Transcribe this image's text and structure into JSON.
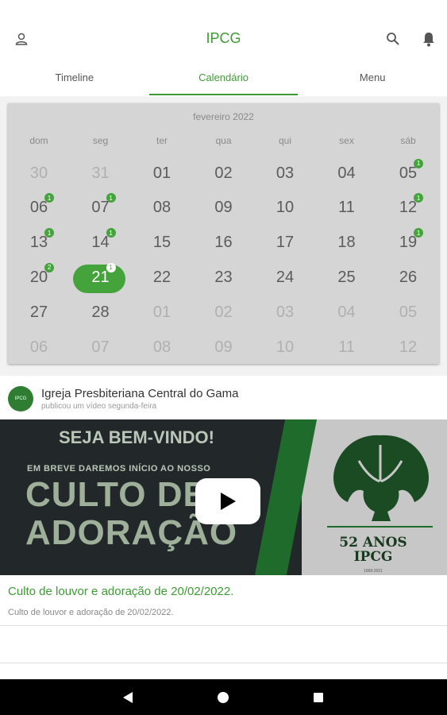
{
  "appbar": {
    "title": "IPCG",
    "profile_icon": "person-icon",
    "search_icon": "search-icon",
    "bell_icon": "bell-icon"
  },
  "tabs": [
    {
      "label": "Timeline",
      "active": false
    },
    {
      "label": "Calendário",
      "active": true
    },
    {
      "label": "Menu",
      "active": false
    }
  ],
  "calendar": {
    "month": "fevereiro 2022",
    "weekdays": [
      "dom",
      "seg",
      "ter",
      "qua",
      "qui",
      "sex",
      "sáb"
    ],
    "accent": "#45a33c",
    "weeks": [
      [
        {
          "d": "30",
          "other": true
        },
        {
          "d": "31",
          "other": true
        },
        {
          "d": "01"
        },
        {
          "d": "02"
        },
        {
          "d": "03"
        },
        {
          "d": "04"
        },
        {
          "d": "05",
          "badge": "1"
        }
      ],
      [
        {
          "d": "06",
          "badge": "1"
        },
        {
          "d": "07",
          "badge": "1"
        },
        {
          "d": "08"
        },
        {
          "d": "09"
        },
        {
          "d": "10"
        },
        {
          "d": "11"
        },
        {
          "d": "12",
          "badge": "1"
        }
      ],
      [
        {
          "d": "13",
          "badge": "1"
        },
        {
          "d": "14",
          "badge": "1"
        },
        {
          "d": "15"
        },
        {
          "d": "16"
        },
        {
          "d": "17"
        },
        {
          "d": "18"
        },
        {
          "d": "19",
          "badge": "1"
        }
      ],
      [
        {
          "d": "20",
          "badge": "2"
        },
        {
          "d": "21",
          "badge": "1",
          "selected": true
        },
        {
          "d": "22"
        },
        {
          "d": "23"
        },
        {
          "d": "24"
        },
        {
          "d": "25"
        },
        {
          "d": "26"
        }
      ],
      [
        {
          "d": "27"
        },
        {
          "d": "28"
        },
        {
          "d": "01",
          "other": true
        },
        {
          "d": "02",
          "other": true
        },
        {
          "d": "03",
          "other": true
        },
        {
          "d": "04",
          "other": true
        },
        {
          "d": "05",
          "other": true
        }
      ],
      [
        {
          "d": "06",
          "other": true
        },
        {
          "d": "07",
          "other": true
        },
        {
          "d": "08",
          "other": true
        },
        {
          "d": "09",
          "other": true
        },
        {
          "d": "10",
          "other": true
        },
        {
          "d": "11",
          "other": true
        },
        {
          "d": "12",
          "other": true
        }
      ]
    ]
  },
  "post": {
    "avatar_text": "IPCG",
    "author": "Igreja Presbiteriana Central do Gama",
    "subtitle": "publicou um vídeo segunda-feira",
    "video": {
      "line1": "SEJA BEM-VINDO!",
      "line2": "EM BREVE DAREMOS INÍCIO AO NOSSO",
      "line3": "CULTO DE",
      "line4": "ADORAÇÃO",
      "badge_line1": "52 ANOS",
      "badge_line2": "IPCG",
      "years": "1969-2021"
    },
    "title": "Culto de louvor e adoração de 20/02/2022.",
    "description": "Culto de louvor e adoração de 20/02/2022."
  },
  "navbar": {
    "back_icon": "back-triangle-icon",
    "home_icon": "home-circle-icon",
    "recents_icon": "recents-square-icon"
  }
}
